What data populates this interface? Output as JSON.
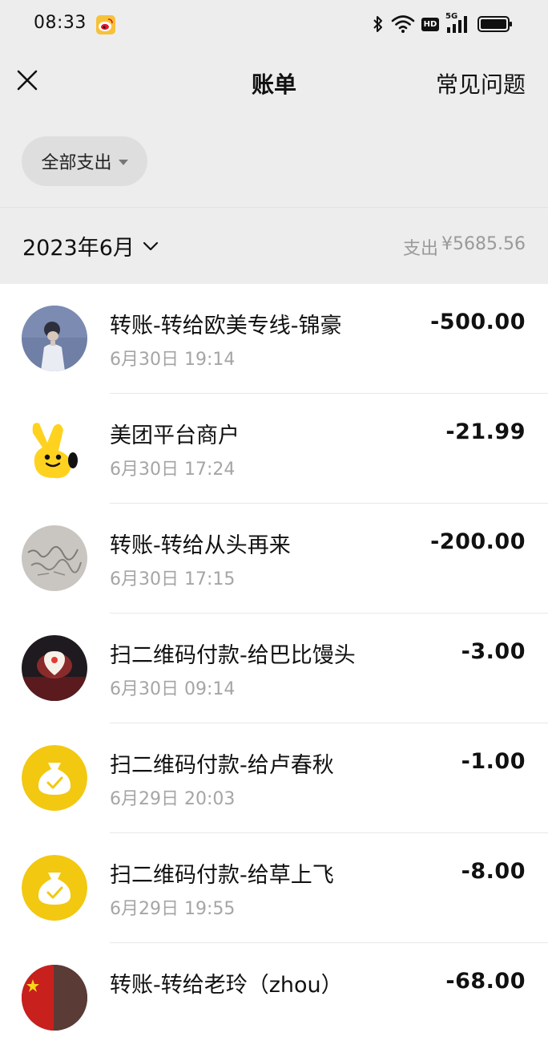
{
  "status_bar": {
    "time": "08:33",
    "network": "5G",
    "hd": "HD"
  },
  "nav": {
    "title": "账单",
    "faq_label": "常见问题"
  },
  "filter": {
    "label": "全部支出"
  },
  "month": {
    "label": "2023年6月",
    "summary_label": "支出",
    "summary_value": "¥5685.56"
  },
  "transactions": [
    {
      "title": "转账-转给欧美专线-锦豪",
      "time": "6月30日 19:14",
      "amount": "-500.00",
      "avatar": "portrait-photo"
    },
    {
      "title": "美团平台商户",
      "time": "6月30日 17:24",
      "amount": "-21.99",
      "avatar": "meituan-mascot"
    },
    {
      "title": "转账-转给从头再来",
      "time": "6月30日 17:15",
      "amount": "-200.00",
      "avatar": "calligraphy-photo"
    },
    {
      "title": "扫二维码付款-给巴比馒头",
      "time": "6月30日 09:14",
      "amount": "-3.00",
      "avatar": "babi-store-logo"
    },
    {
      "title": "扫二维码付款-给卢春秋",
      "time": "6月29日 20:03",
      "amount": "-1.00",
      "avatar": "money-bag-icon"
    },
    {
      "title": "扫二维码付款-给草上飞",
      "time": "6月29日 19:55",
      "amount": "-8.00",
      "avatar": "money-bag-icon"
    },
    {
      "title": "转账-转给老玲（zhou）",
      "time": "",
      "amount": "-68.00",
      "avatar": "flag-photo"
    }
  ],
  "colors": {
    "header_bg": "#ededed",
    "money_bag_yellow": "#f2c811",
    "secondary_text": "#a5a5a5"
  }
}
